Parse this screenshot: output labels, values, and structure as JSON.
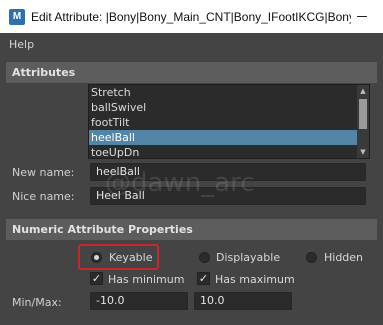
{
  "window": {
    "icon_letter": "M",
    "title": "Edit Attribute: |Bony|Bony_Main_CNT|Bony_IFootIKCG|Bony..."
  },
  "menu": {
    "help": "Help"
  },
  "attributes": {
    "header": "Attributes",
    "list": [
      "Stretch",
      "ballSwivel",
      "footTilt",
      "heelBall",
      "toeUpDn"
    ],
    "selected_index": 3,
    "new_name_label": "New name:",
    "new_name_value": "heelBall",
    "nice_name_label": "Nice name:",
    "nice_name_value": "Heel Ball"
  },
  "numeric": {
    "header": "Numeric Attribute Properties",
    "keyable": "Keyable",
    "displayable": "Displayable",
    "hidden": "Hidden",
    "selected": "keyable",
    "has_minimum": "Has minimum",
    "has_maximum": "Has maximum",
    "minmax_label": "Min/Max:",
    "min_value": "-10.0",
    "max_value": "10.0"
  },
  "watermark": "@dawn_arc",
  "colors": {
    "selection": "#5285a6",
    "highlight": "#c8272d",
    "panel": "#444444"
  }
}
